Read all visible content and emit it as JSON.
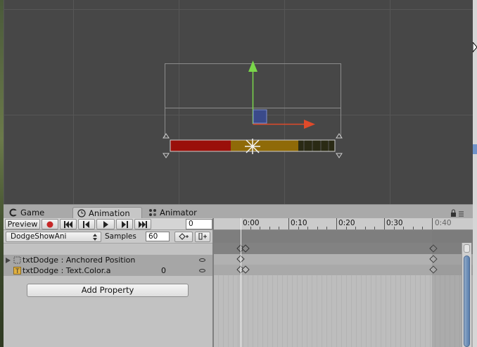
{
  "tabs": [
    {
      "label": "Game",
      "icon": "game-icon"
    },
    {
      "label": "Animation",
      "icon": "clock-icon",
      "active": true
    },
    {
      "label": "Animator",
      "icon": "animator-icon"
    }
  ],
  "toolbar": {
    "preview_label": "Preview",
    "record_color": "#c62828",
    "frame_value": "0"
  },
  "clip": {
    "name": "DodgeShowAni",
    "samples_label": "Samples",
    "samples_value": "60"
  },
  "properties": [
    {
      "name": "txtDodge : Anchored Position",
      "value": "",
      "expandable": true
    },
    {
      "name": "txtDodge : Text.Color.a",
      "value": "0",
      "expandable": false
    }
  ],
  "add_property_label": "Add Property",
  "timeline": {
    "ticks": [
      "0:00",
      "0:10",
      "0:20",
      "0:30",
      "0:40"
    ]
  },
  "scene": {
    "bar_colors": [
      "#9a0f0a",
      "#8f6a08",
      "#2a2a14"
    ],
    "y_axis_color": "#7ad64a",
    "x_axis_color": "#e04a2a"
  }
}
